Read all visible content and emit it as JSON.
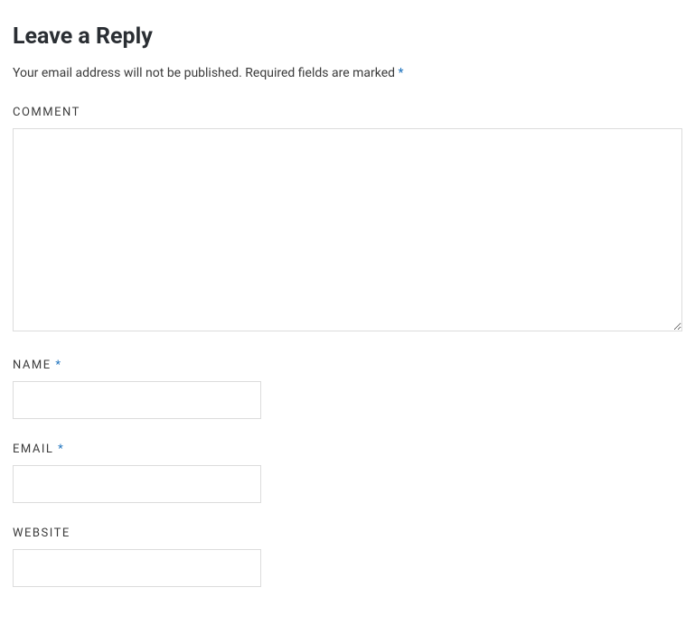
{
  "heading": "Leave a Reply",
  "intro": {
    "line1": "Your email address will not be published.",
    "line2": "Required fields are marked",
    "mark": "*"
  },
  "fields": {
    "comment": {
      "label": "COMMENT",
      "value": ""
    },
    "name": {
      "label": "NAME",
      "required_mark": "*",
      "value": ""
    },
    "email": {
      "label": "EMAIL",
      "required_mark": "*",
      "value": ""
    },
    "website": {
      "label": "WEBSITE",
      "value": ""
    }
  }
}
